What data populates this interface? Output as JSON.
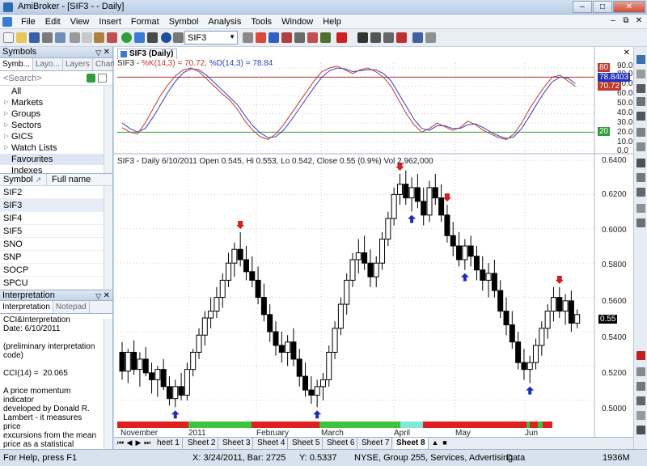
{
  "window": {
    "title": "AmiBroker - [SIF3 -  - Daily]"
  },
  "menu": [
    "File",
    "Edit",
    "View",
    "Insert",
    "Format",
    "Symbol",
    "Analysis",
    "Tools",
    "Window",
    "Help"
  ],
  "toolbar": {
    "symbol_value": "SIF3"
  },
  "symbols_panel": {
    "title": "Symbols",
    "tabs": [
      "Symb...",
      "Layo...",
      "Layers",
      "Charts"
    ],
    "search_placeholder": "<Search>",
    "tree": [
      "All",
      "Markets",
      "Groups",
      "Sectors",
      "GICS",
      "Watch Lists",
      "Favourites",
      "Indexes"
    ],
    "col_symbol": "Symbol",
    "col_fullname": "Full name",
    "symbols": [
      "SIF2",
      "SIF3",
      "SIF4",
      "SIF5",
      "SNO",
      "SNP",
      "SOCP",
      "SPCU"
    ]
  },
  "interpretation": {
    "title": "Interpretation",
    "tabs": [
      "Interpretation",
      "Notepad"
    ],
    "text": "CCI&Interpretation\nDate: 6/10/2011\n\n(preliminary interpretation\ncode)\n\nCCI(14) =  20.065\n\nA price momentum indicator\ndeveloped by Donald R.\nLambert - it measures price\nexcursions from the mean\nprice as a statistical variation\n\nCCI is now in neutral range"
  },
  "chart": {
    "tab_label": "SIF3 (Daily)",
    "ind_prefix": "SIF3 - ",
    "ind_k": "%K(14,3) = 70.72,",
    "ind_d": "%D(14,3) = 78.84",
    "main_label": "SIF3 - Daily 6/10/2011 Open 0.545, Hi 0.553, Lo 0.542, Close 0.55 (0.9%) Vol 2,962,000",
    "ind_axis": [
      "90.0",
      "80.0",
      "70.0",
      "60.0",
      "50.0",
      "40.0",
      "30.0",
      "20.0",
      "10.0",
      "0.0"
    ],
    "ind_badges": {
      "d": "78.8403",
      "k": "70.72",
      "top": "80",
      "low": "20"
    },
    "price_axis": [
      "0.6400",
      "0.6200",
      "0.6000",
      "0.5800",
      "0.5600",
      "0.5400",
      "0.5200",
      "0.5000"
    ],
    "last_price": "0.55",
    "months": [
      "November",
      "2011",
      "February",
      "March",
      "April",
      "May",
      "Jun"
    ],
    "colors": {
      "stoch_k": "#c0392b",
      "stoch_d": "#3040c8",
      "upper_line": "#b03030",
      "lower_line": "#2e9e3a",
      "up_arrow": "#1a2fb0",
      "down_arrow": "#d02020"
    }
  },
  "chart_data": {
    "type": "candlestick",
    "ylim": [
      0.49,
      0.64
    ],
    "candles": [
      [
        0.528,
        0.534,
        0.512,
        0.517
      ],
      [
        0.517,
        0.53,
        0.51,
        0.528
      ],
      [
        0.528,
        0.535,
        0.515,
        0.518
      ],
      [
        0.518,
        0.528,
        0.508,
        0.524
      ],
      [
        0.524,
        0.531,
        0.514,
        0.516
      ],
      [
        0.516,
        0.522,
        0.504,
        0.512
      ],
      [
        0.512,
        0.52,
        0.502,
        0.518
      ],
      [
        0.518,
        0.524,
        0.506,
        0.508
      ],
      [
        0.508,
        0.514,
        0.497,
        0.501
      ],
      [
        0.501,
        0.512,
        0.496,
        0.508
      ],
      [
        0.508,
        0.516,
        0.5,
        0.503
      ],
      [
        0.503,
        0.522,
        0.5,
        0.518
      ],
      [
        0.518,
        0.53,
        0.514,
        0.528
      ],
      [
        0.528,
        0.542,
        0.524,
        0.538
      ],
      [
        0.538,
        0.552,
        0.532,
        0.548
      ],
      [
        0.548,
        0.56,
        0.542,
        0.552
      ],
      [
        0.552,
        0.566,
        0.548,
        0.56
      ],
      [
        0.56,
        0.574,
        0.554,
        0.57
      ],
      [
        0.57,
        0.586,
        0.566,
        0.58
      ],
      [
        0.58,
        0.592,
        0.572,
        0.588
      ],
      [
        0.588,
        0.598,
        0.578,
        0.582
      ],
      [
        0.582,
        0.59,
        0.57,
        0.575
      ],
      [
        0.575,
        0.584,
        0.566,
        0.57
      ],
      [
        0.57,
        0.578,
        0.556,
        0.56
      ],
      [
        0.56,
        0.568,
        0.546,
        0.55
      ],
      [
        0.55,
        0.556,
        0.534,
        0.54
      ],
      [
        0.54,
        0.546,
        0.526,
        0.532
      ],
      [
        0.532,
        0.54,
        0.522,
        0.528
      ],
      [
        0.528,
        0.538,
        0.52,
        0.534
      ],
      [
        0.534,
        0.542,
        0.52,
        0.524
      ],
      [
        0.524,
        0.53,
        0.508,
        0.514
      ],
      [
        0.514,
        0.522,
        0.502,
        0.506
      ],
      [
        0.506,
        0.514,
        0.498,
        0.503
      ],
      [
        0.503,
        0.512,
        0.496,
        0.508
      ],
      [
        0.508,
        0.516,
        0.5,
        0.512
      ],
      [
        0.512,
        0.532,
        0.508,
        0.528
      ],
      [
        0.528,
        0.546,
        0.524,
        0.542
      ],
      [
        0.542,
        0.56,
        0.538,
        0.556
      ],
      [
        0.556,
        0.574,
        0.55,
        0.57
      ],
      [
        0.57,
        0.586,
        0.566,
        0.582
      ],
      [
        0.582,
        0.594,
        0.574,
        0.586
      ],
      [
        0.586,
        0.596,
        0.576,
        0.58
      ],
      [
        0.58,
        0.588,
        0.566,
        0.572
      ],
      [
        0.572,
        0.584,
        0.566,
        0.58
      ],
      [
        0.58,
        0.598,
        0.576,
        0.594
      ],
      [
        0.594,
        0.61,
        0.59,
        0.606
      ],
      [
        0.606,
        0.624,
        0.602,
        0.62
      ],
      [
        0.62,
        0.632,
        0.614,
        0.626
      ],
      [
        0.626,
        0.634,
        0.614,
        0.618
      ],
      [
        0.618,
        0.63,
        0.61,
        0.624
      ],
      [
        0.624,
        0.632,
        0.612,
        0.616
      ],
      [
        0.616,
        0.624,
        0.602,
        0.608
      ],
      [
        0.608,
        0.628,
        0.604,
        0.624
      ],
      [
        0.624,
        0.632,
        0.614,
        0.618
      ],
      [
        0.618,
        0.626,
        0.604,
        0.608
      ],
      [
        0.608,
        0.614,
        0.592,
        0.596
      ],
      [
        0.596,
        0.604,
        0.584,
        0.59
      ],
      [
        0.59,
        0.598,
        0.578,
        0.582
      ],
      [
        0.582,
        0.594,
        0.576,
        0.59
      ],
      [
        0.59,
        0.596,
        0.578,
        0.584
      ],
      [
        0.584,
        0.59,
        0.57,
        0.576
      ],
      [
        0.576,
        0.584,
        0.564,
        0.57
      ],
      [
        0.57,
        0.58,
        0.56,
        0.574
      ],
      [
        0.574,
        0.582,
        0.56,
        0.564
      ],
      [
        0.564,
        0.57,
        0.548,
        0.552
      ],
      [
        0.552,
        0.56,
        0.538,
        0.544
      ],
      [
        0.544,
        0.552,
        0.53,
        0.534
      ],
      [
        0.534,
        0.54,
        0.518,
        0.522
      ],
      [
        0.522,
        0.53,
        0.512,
        0.518
      ],
      [
        0.518,
        0.526,
        0.51,
        0.522
      ],
      [
        0.522,
        0.536,
        0.518,
        0.532
      ],
      [
        0.532,
        0.546,
        0.526,
        0.542
      ],
      [
        0.542,
        0.556,
        0.536,
        0.552
      ],
      [
        0.552,
        0.566,
        0.546,
        0.56
      ],
      [
        0.56,
        0.566,
        0.548,
        0.552
      ],
      [
        0.552,
        0.562,
        0.544,
        0.558
      ],
      [
        0.558,
        0.564,
        0.54,
        0.545
      ],
      [
        0.545,
        0.553,
        0.542,
        0.55
      ]
    ],
    "stoch_k": [
      25,
      20,
      18,
      30,
      45,
      60,
      72,
      82,
      88,
      90,
      86,
      78,
      70,
      62,
      55,
      45,
      32,
      22,
      15,
      12,
      18,
      28,
      40,
      52,
      64,
      76,
      86,
      90,
      92,
      88,
      84,
      88,
      90,
      86,
      80,
      70,
      55,
      40,
      28,
      20,
      24,
      30,
      26,
      22,
      25,
      32,
      28,
      22,
      18,
      14,
      12,
      18,
      30,
      45,
      58,
      70,
      80,
      82,
      76,
      70
    ],
    "stoch_d": [
      30,
      24,
      20,
      24,
      36,
      50,
      64,
      76,
      85,
      89,
      88,
      82,
      74,
      66,
      58,
      50,
      38,
      27,
      19,
      14,
      15,
      22,
      33,
      45,
      57,
      69,
      80,
      87,
      90,
      89,
      86,
      87,
      88,
      88,
      84,
      76,
      62,
      48,
      34,
      24,
      22,
      27,
      27,
      24,
      24,
      28,
      29,
      25,
      20,
      16,
      13,
      15,
      24,
      37,
      51,
      64,
      75,
      80,
      79,
      73
    ]
  }
}
